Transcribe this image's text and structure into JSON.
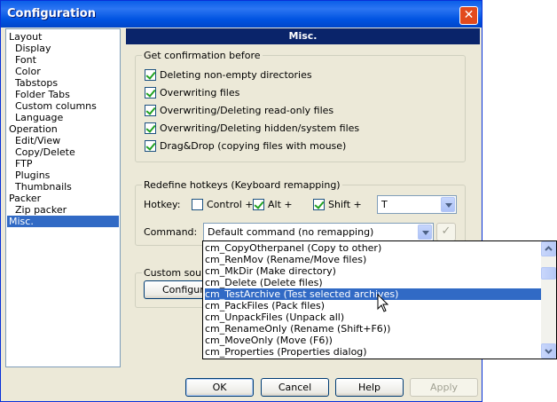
{
  "window": {
    "title": "Configuration"
  },
  "tree": {
    "items": [
      {
        "label": "Layout"
      },
      {
        "label": "Display"
      },
      {
        "label": "Font"
      },
      {
        "label": "Color"
      },
      {
        "label": "Tabstops"
      },
      {
        "label": "Folder Tabs"
      },
      {
        "label": "Custom columns"
      },
      {
        "label": "Language"
      },
      {
        "label": "Operation"
      },
      {
        "label": "Edit/View"
      },
      {
        "label": "Copy/Delete"
      },
      {
        "label": "FTP"
      },
      {
        "label": "Plugins"
      },
      {
        "label": "Thumbnails"
      },
      {
        "label": "Packer"
      },
      {
        "label": "Zip packer"
      },
      {
        "label": "Misc."
      }
    ],
    "selected": "Misc."
  },
  "panel": {
    "header": "Misc."
  },
  "confirm": {
    "group_label": "Get confirmation before",
    "items": [
      {
        "label": "Deleting non-empty directories",
        "checked": true
      },
      {
        "label": "Overwriting files",
        "checked": true
      },
      {
        "label": "Overwriting/Deleting read-only files",
        "checked": true
      },
      {
        "label": "Overwriting/Deleting hidden/system files",
        "checked": true
      },
      {
        "label": "Drag&Drop (copying files with mouse)",
        "checked": true
      }
    ]
  },
  "hotkeys": {
    "group_label": "Redefine hotkeys (Keyboard remapping)",
    "hotkey_label": "Hotkey:",
    "control_label": "Control +",
    "control_checked": false,
    "alt_label": "Alt +",
    "alt_checked": true,
    "shift_label": "Shift +",
    "shift_checked": true,
    "key_value": "T",
    "command_label": "Command:",
    "command_value": "Default command (no remapping)"
  },
  "sounds": {
    "group_label": "Custom sound",
    "configure_label": "Configure"
  },
  "dropdown": {
    "items": [
      "cm_CopyOtherpanel (Copy to other)",
      "cm_RenMov (Rename/Move files)",
      "cm_MkDir (Make directory)",
      "cm_Delete (Delete files)",
      "cm_TestArchive (Test selected archives)",
      "cm_PackFiles (Pack files)",
      "cm_UnpackFiles (Unpack all)",
      "cm_RenameOnly (Rename (Shift+F6))",
      "cm_MoveOnly (Move (F6))",
      "cm_Properties (Properties dialog)"
    ],
    "highlighted": "cm_TestArchive (Test selected archives)"
  },
  "buttons": {
    "ok": "OK",
    "cancel": "Cancel",
    "help": "Help",
    "apply": "Apply"
  },
  "colors": {
    "title_bar": "#0058e6",
    "selection": "#316ac5",
    "header": "#0a246a"
  }
}
